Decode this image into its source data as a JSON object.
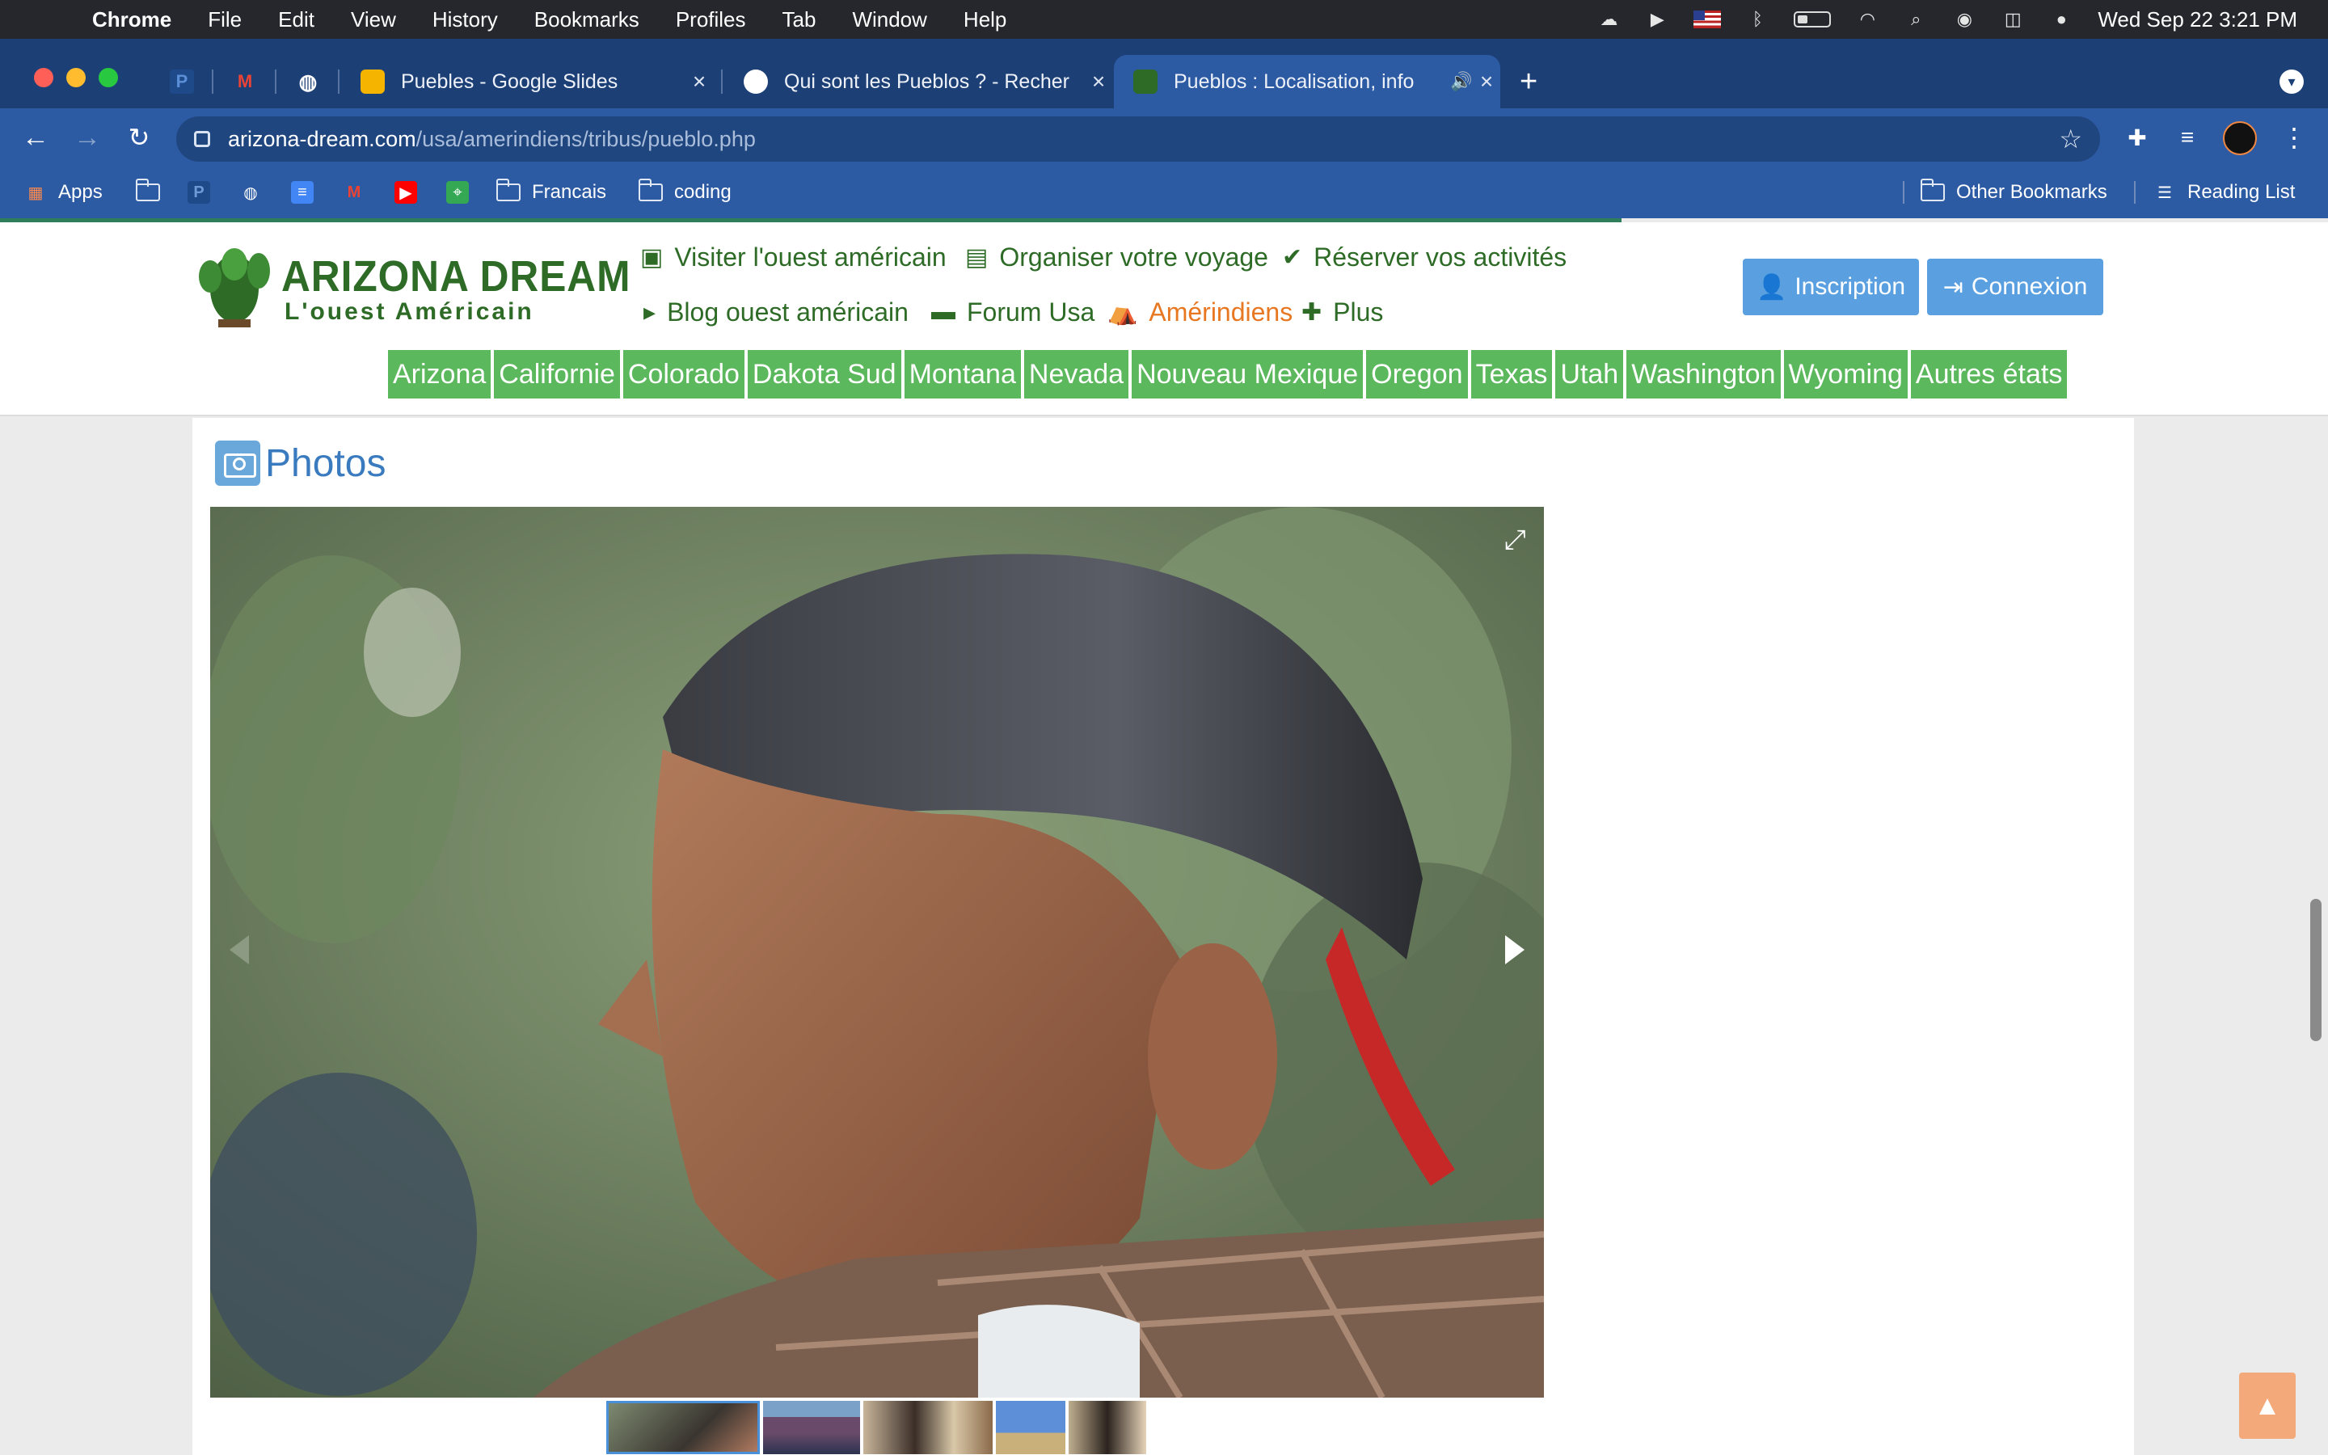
{
  "menubar": {
    "app_name": "Chrome",
    "items": [
      "File",
      "Edit",
      "View",
      "History",
      "Bookmarks",
      "Profiles",
      "Tab",
      "Window",
      "Help"
    ],
    "clock": "Wed Sep 22  3:21 PM"
  },
  "tabs": [
    {
      "title": "Puebles - Google Slides",
      "favicon": "google-slides-icon"
    },
    {
      "title": "Qui sont les Pueblos ? - Recher",
      "favicon": "google-icon"
    },
    {
      "title": "Pueblos : Localisation, info",
      "favicon": "cactus-icon",
      "active": true
    }
  ],
  "omnibox": {
    "host": "arizona-dream.com",
    "path": "/usa/amerindiens/tribus/pueblo.php"
  },
  "bookmarks": {
    "apps": "Apps",
    "folder1": "Francais",
    "folder2": "coding",
    "other": "Other Bookmarks",
    "reading": "Reading List"
  },
  "site": {
    "brand": "ARIZONA DREAM",
    "tagline": "L'ouest Américain",
    "nav": {
      "visit": "Visiter l'ouest américain",
      "organize": "Organiser votre voyage",
      "book": "Réserver vos activités",
      "blog": "Blog ouest américain",
      "forum": "Forum Usa",
      "amerindians": "Amérindiens",
      "more": "Plus"
    },
    "signup": "Inscription",
    "login": "Connexion",
    "states": [
      "Arizona",
      "Californie",
      "Colorado",
      "Dakota Sud",
      "Montana",
      "Nevada",
      "Nouveau Mexique",
      "Oregon",
      "Texas",
      "Utah",
      "Washington",
      "Wyoming",
      "Autres états"
    ]
  },
  "section": {
    "title": "Photos"
  },
  "colors": {
    "chrome_tabstrip": "#1c3f76",
    "chrome_toolbar": "#2c5aa3",
    "site_green": "#2d6b26",
    "state_green": "#5cb85c",
    "accent_blue": "#5aa0e0",
    "amerindiens_orange": "#e87722"
  }
}
